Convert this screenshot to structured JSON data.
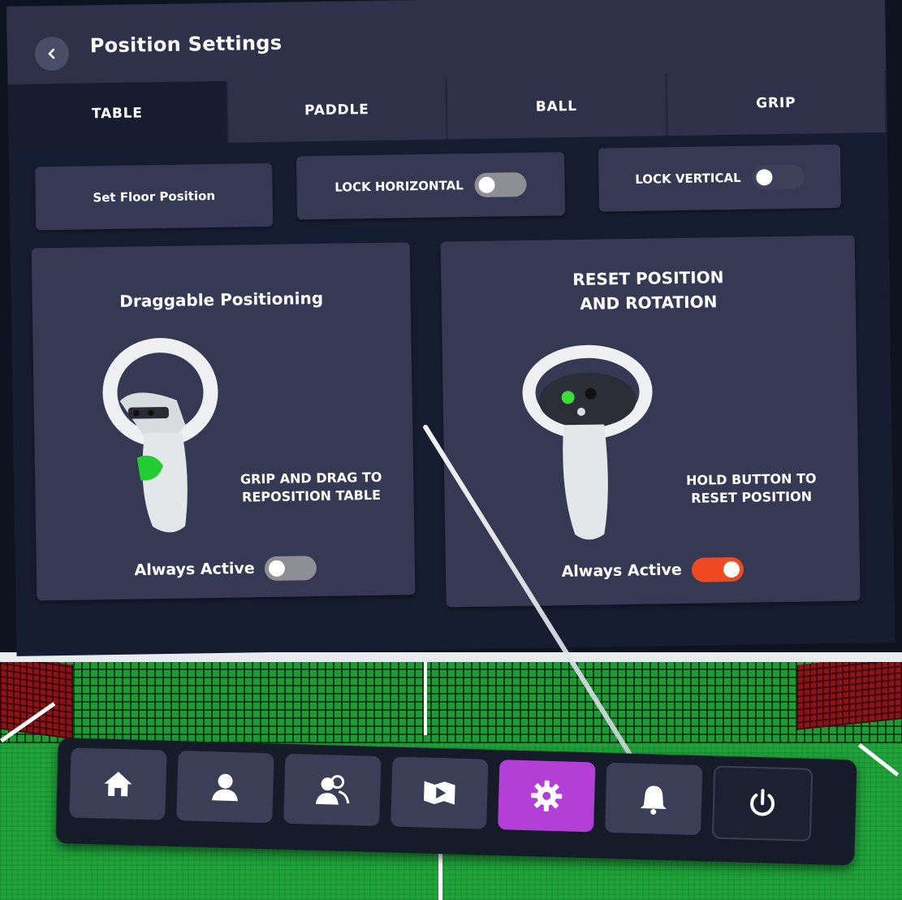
{
  "header": {
    "title": "Position Settings"
  },
  "tabs": [
    {
      "label": "TABLE",
      "active": true
    },
    {
      "label": "PADDLE",
      "active": false
    },
    {
      "label": "BALL",
      "active": false
    },
    {
      "label": "GRIP",
      "active": false
    }
  ],
  "controls": {
    "set_floor_label": "Set Floor Position",
    "lock_horizontal_label": "LOCK HORIZONTAL",
    "lock_horizontal_on": false,
    "lock_vertical_label": "LOCK VERTICAL",
    "lock_vertical_on": false
  },
  "cards": {
    "draggable": {
      "title": "Draggable Positioning",
      "description_line1": "GRIP AND DRAG TO",
      "description_line2": "REPOSITION TABLE",
      "footer_label": "Always Active",
      "toggle_on": false
    },
    "reset": {
      "title_line1": "RESET POSITION",
      "title_line2": "AND ROTATION",
      "description_line1": "HOLD BUTTON TO",
      "description_line2": "RESET POSITION",
      "footer_label": "Always Active",
      "toggle_on": true
    }
  },
  "dock": {
    "items": [
      "home-icon",
      "user-icon",
      "friends-icon",
      "media-icon",
      "settings-icon",
      "notifications-icon",
      "power-icon"
    ],
    "active": "settings-icon"
  },
  "colors": {
    "accent_on": "#f04a24",
    "active_dock": "#b33fd6",
    "highlight_button": "#3ddc3d"
  }
}
